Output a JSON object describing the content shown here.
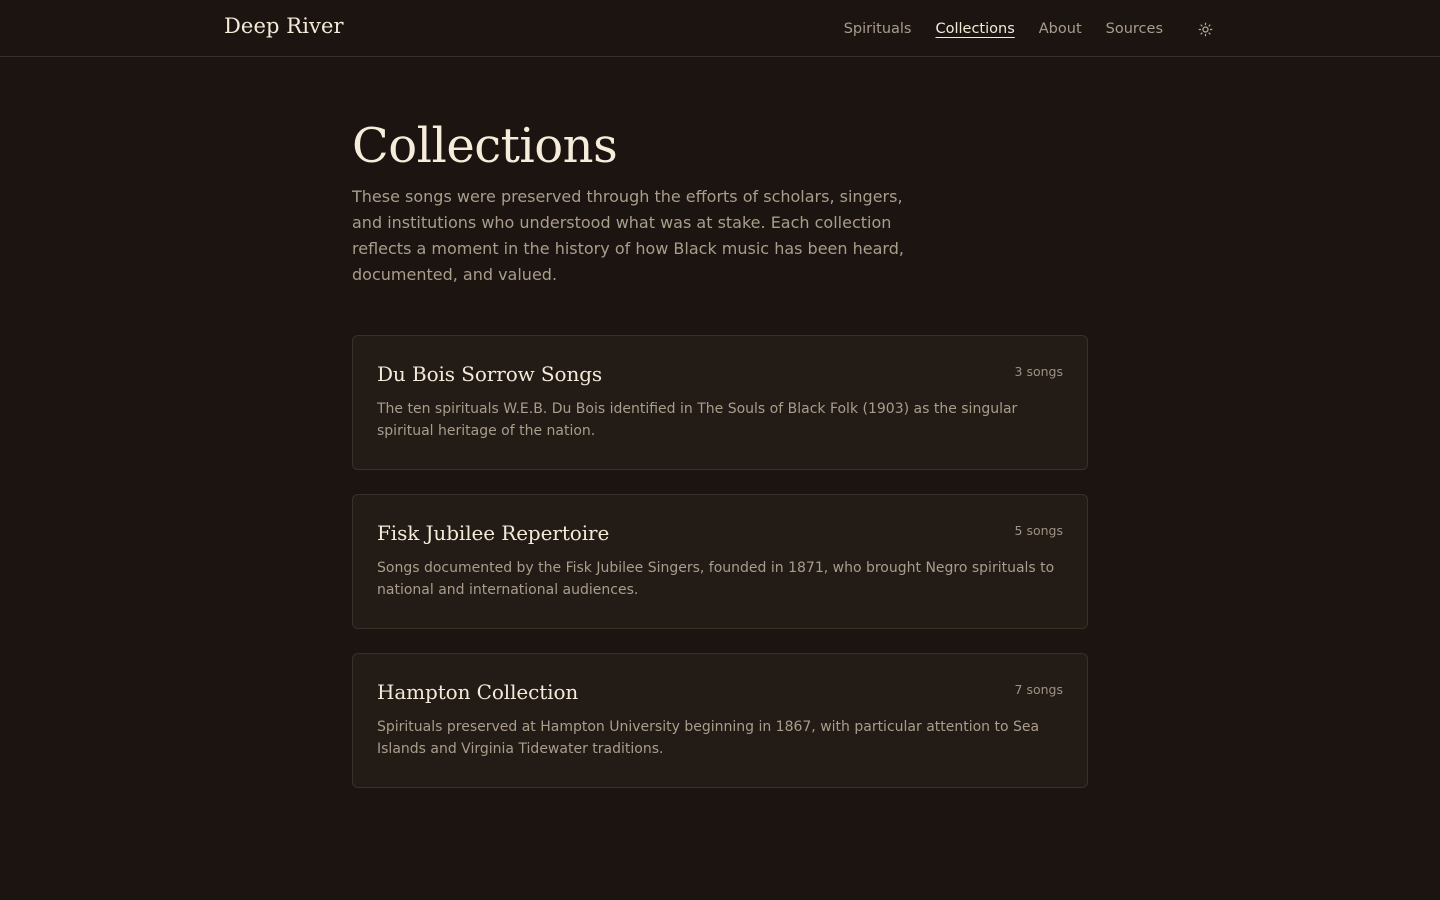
{
  "brand": "Deep River",
  "nav": {
    "items": [
      {
        "label": "Spirituals",
        "active": false
      },
      {
        "label": "Collections",
        "active": true
      },
      {
        "label": "About",
        "active": false
      },
      {
        "label": "Sources",
        "active": false
      }
    ],
    "theme_icon": "sun-icon"
  },
  "page": {
    "title": "Collections",
    "intro": "These songs were preserved through the efforts of scholars, singers, and institutions who understood what was at stake. Each collection reflects a moment in the history of how Black music has been heard, documented, and valued."
  },
  "collections": [
    {
      "title": "Du Bois Sorrow Songs",
      "count": "3 songs",
      "description": "The ten spirituals W.E.B. Du Bois identified in The Souls of Black Folk (1903) as the singular spiritual heritage of the nation."
    },
    {
      "title": "Fisk Jubilee Repertoire",
      "count": "5 songs",
      "description": "Songs documented by the Fisk Jubilee Singers, founded in 1871, who brought Negro spirituals to national and international audiences."
    },
    {
      "title": "Hampton Collection",
      "count": "7 songs",
      "description": "Spirituals preserved at Hampton University beginning in 1867, with particular attention to Sea Islands and Virginia Tidewater traditions."
    }
  ],
  "colors": {
    "background": "#1c1411",
    "card_background": "#231b16",
    "border": "#3b3029",
    "text_primary": "#f3ead8",
    "text_muted": "#a99d8b"
  }
}
